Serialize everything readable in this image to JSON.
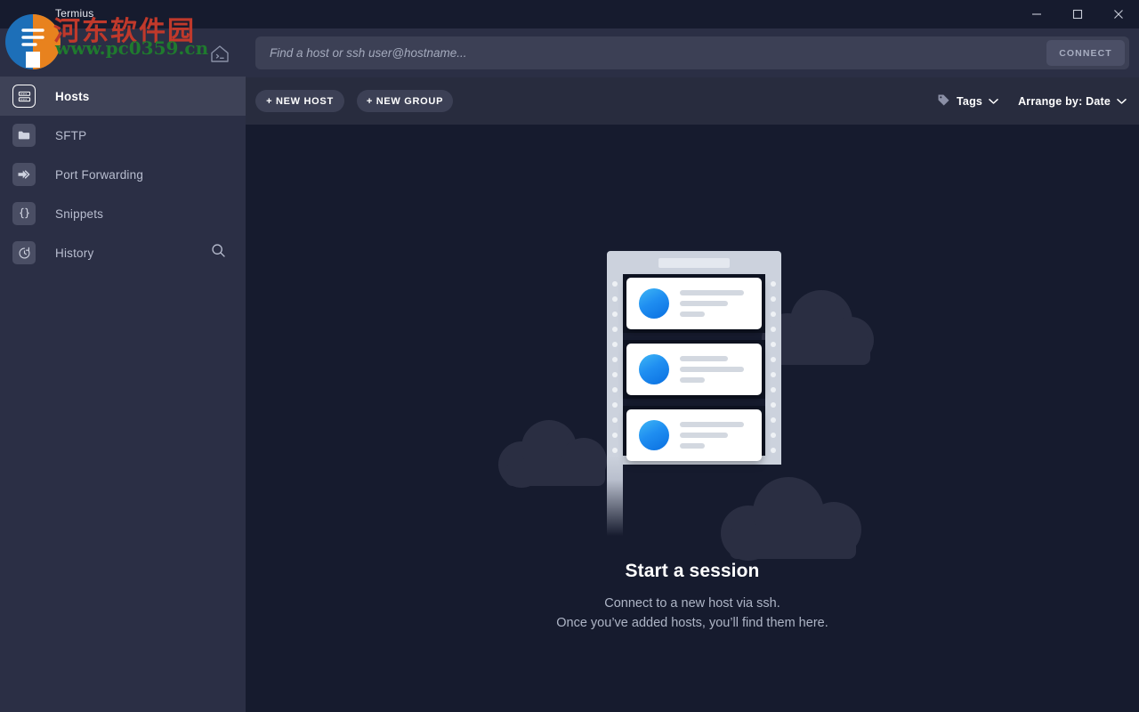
{
  "window": {
    "title": "Termius",
    "minimize_icon": "minimize-icon",
    "maximize_icon": "maximize-icon",
    "close_icon": "close-icon"
  },
  "sidebar": {
    "menu_icon": "hamburger-menu-icon",
    "home_icon": "home-terminal-icon",
    "search_icon": "search-icon",
    "items": [
      {
        "label": "Hosts",
        "icon": "server-rack-icon",
        "active": true
      },
      {
        "label": "SFTP",
        "icon": "folder-icon",
        "active": false
      },
      {
        "label": "Port Forwarding",
        "icon": "arrow-forward-icon",
        "active": false
      },
      {
        "label": "Snippets",
        "icon": "curly-braces-icon",
        "active": false
      },
      {
        "label": "History",
        "icon": "clock-rewind-icon",
        "active": false
      }
    ]
  },
  "search": {
    "placeholder": "Find a host or ssh user@hostname...",
    "value": "",
    "connect_label": "CONNECT"
  },
  "toolbar": {
    "new_host_label": "+ NEW HOST",
    "new_group_label": "+ NEW GROUP",
    "tags_label": "Tags",
    "tags_icon": "tag-icon",
    "arrange_label": "Arrange by: Date",
    "chevron_icon": "chevron-down-icon"
  },
  "empty_state": {
    "illustration": "server-rack-clouds-illustration",
    "headline": "Start a session",
    "line1": "Connect to a new host via ssh.",
    "line2": "Once you’ve added hosts, you’ll find them here."
  },
  "watermark": {
    "chinese": "河东软件园",
    "url": "www.pc0359.cn"
  },
  "colors": {
    "window_bg": "#161b2e",
    "sidebar_bg": "#2b2f45",
    "sidebar_active": "#3e4257",
    "toolbar_bg": "#282c3e",
    "field_bg": "#3c4055",
    "accent_blue": "#1f8ef1",
    "text_primary": "#ffffff",
    "text_muted": "#aeb5c6"
  }
}
